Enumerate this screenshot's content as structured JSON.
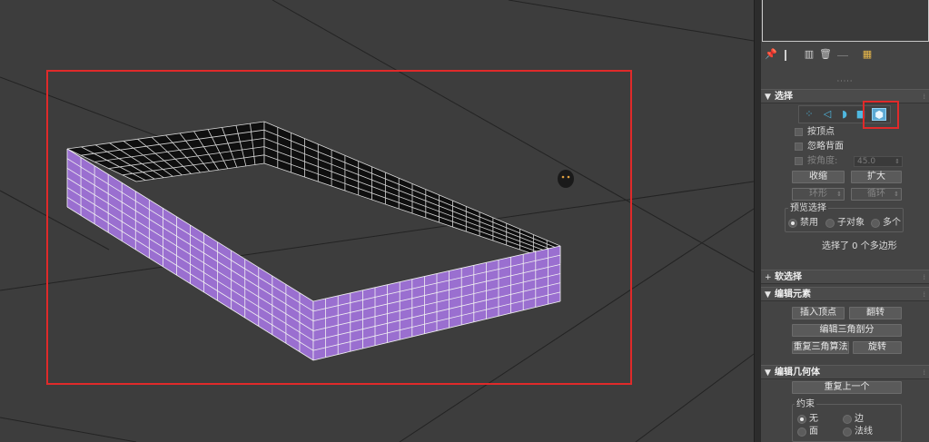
{
  "selection_panel": {
    "title": "选择",
    "modes": [
      "vertex-icon",
      "edge-icon",
      "border-icon",
      "polygon-icon",
      "element-icon"
    ],
    "by_vertex": "按顶点",
    "ignore_backfacing": "忽略背面",
    "by_angle": "按角度:",
    "angle_value": "45.0",
    "shrink": "收缩",
    "grow": "扩大",
    "ring": "环形",
    "loop": "循环",
    "preview_group": "预览选择",
    "preview_options": [
      "禁用",
      "子对象",
      "多个"
    ],
    "preview_selected": "禁用",
    "status": "选择了 0 个多边形"
  },
  "soft_selection": {
    "title": "软选择"
  },
  "edit_elements": {
    "title": "编辑元素",
    "insert_vertex": "插入顶点",
    "flip": "翻转",
    "edit_triangulation": "编辑三角剖分",
    "retriangulate": "重复三角算法",
    "turn": "旋转"
  },
  "edit_geometry": {
    "title": "编辑几何体",
    "repeat_last": "重复上一个",
    "constraints_group": "约束",
    "constraint_options": [
      "无",
      "边",
      "面",
      "法线"
    ],
    "constraint_selected": "无"
  },
  "colors": {
    "wall_outer": "#9a6fd0",
    "wall_inner": "#0f0f0f",
    "highlight": "#e02a2a",
    "active_mode": "#5ca9d3"
  }
}
